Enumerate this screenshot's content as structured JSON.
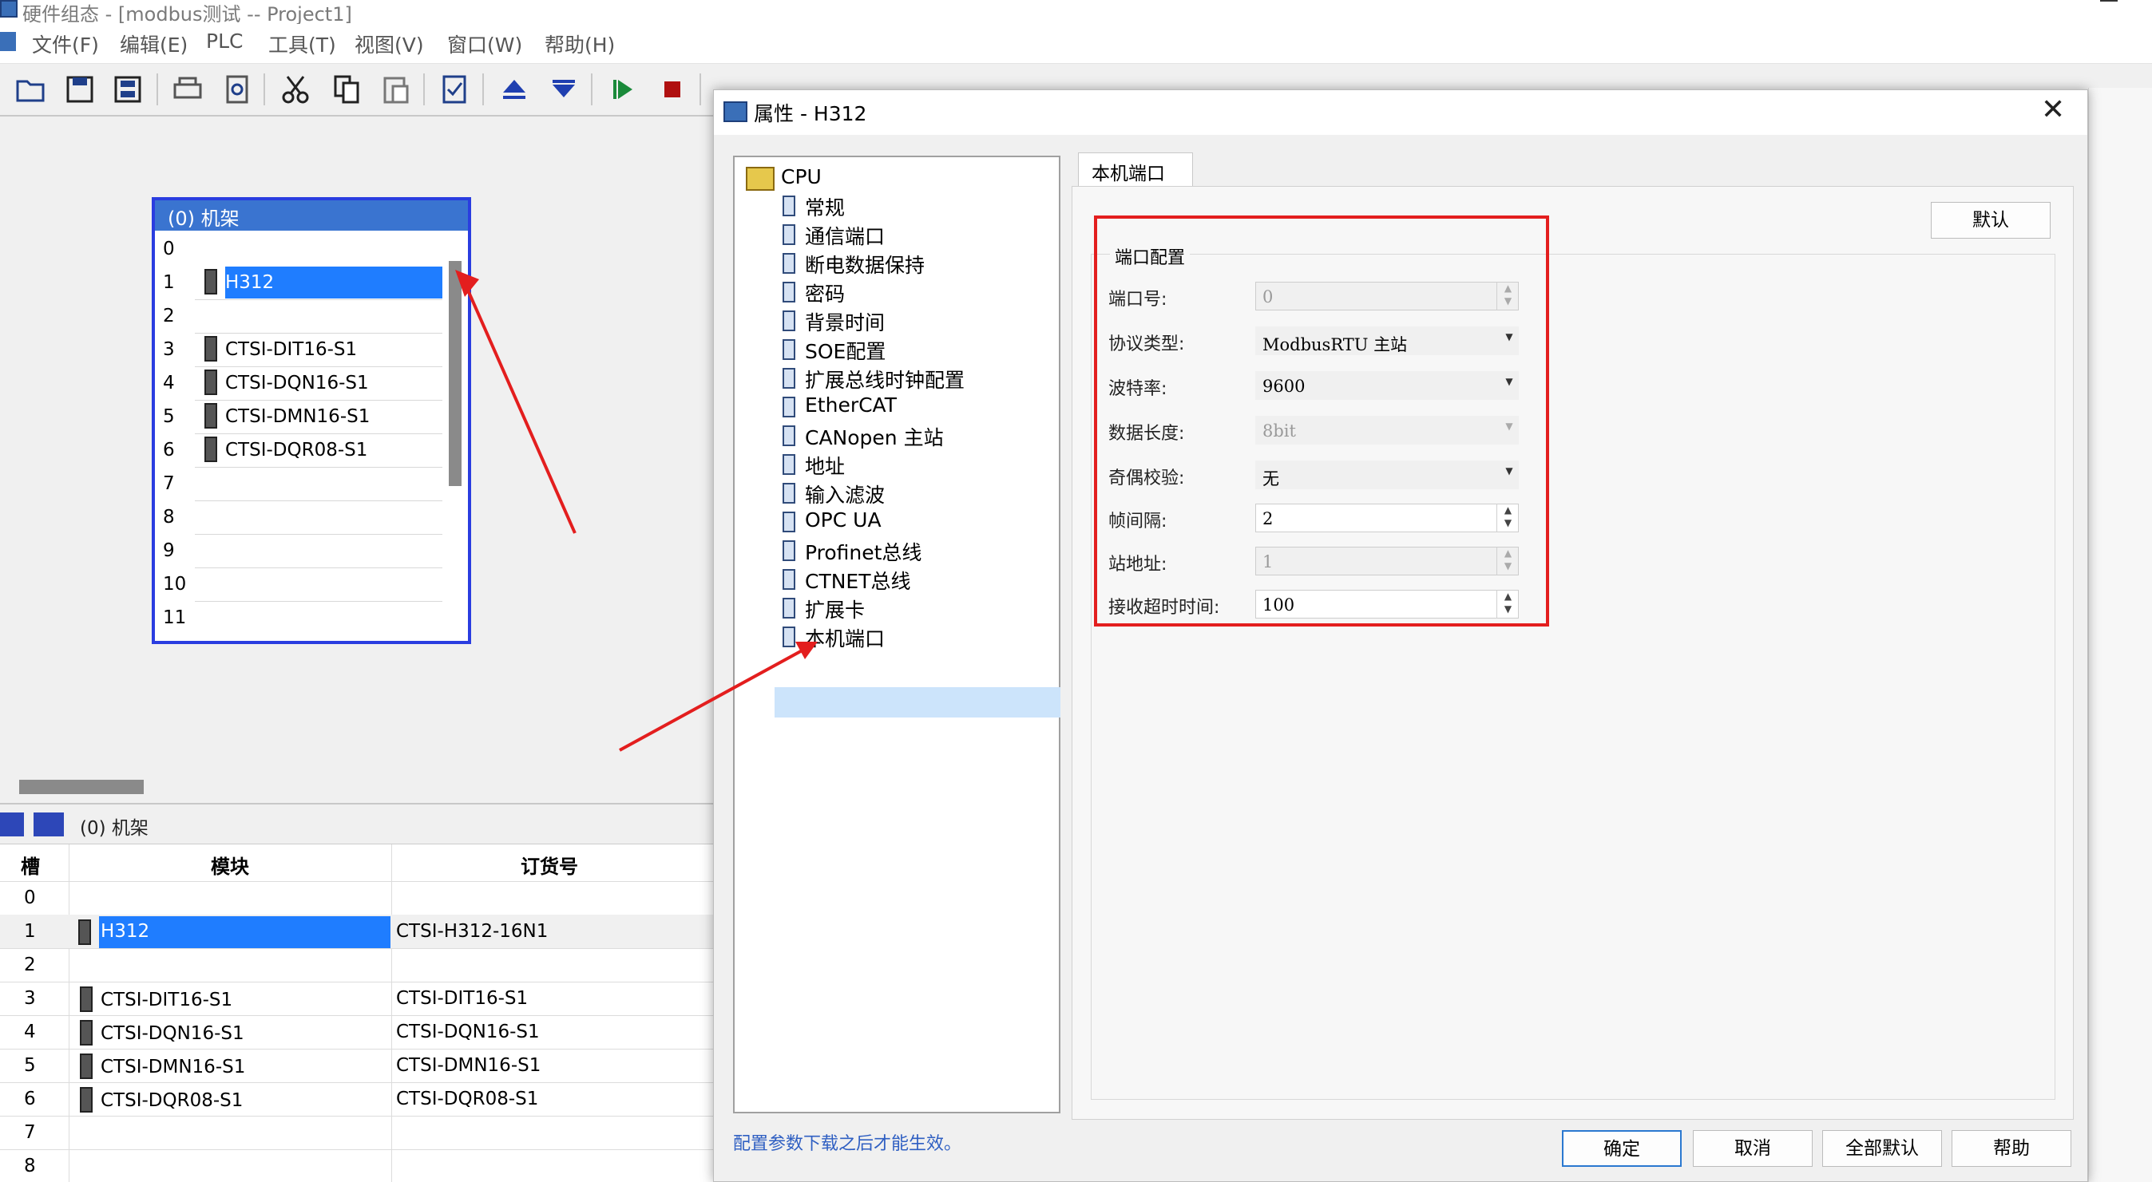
{
  "window": {
    "title": "硬件组态 - [modbus测试 -- Project1]"
  },
  "menu": [
    "文件(F)",
    "编辑(E)",
    "PLC",
    "工具(T)",
    "视图(V)",
    "窗口(W)",
    "帮助(H)"
  ],
  "toolbar_icons": [
    "open-icon",
    "save-icon",
    "save-all-icon",
    "print-icon",
    "print-preview-icon",
    "cut-icon",
    "copy-icon",
    "paste-icon",
    "check-icon",
    "upload-icon",
    "download-icon",
    "run-icon",
    "stop-icon"
  ],
  "rack": {
    "title": "(0)  机架",
    "rows": [
      "0",
      "1",
      "2",
      "3",
      "4",
      "5",
      "6",
      "7",
      "8",
      "9",
      "10",
      "11"
    ],
    "modules": [
      {
        "slot": "1",
        "name": "H312"
      },
      {
        "slot": "3",
        "name": "CTSI-DIT16-S1"
      },
      {
        "slot": "4",
        "name": "CTSI-DQN16-S1"
      },
      {
        "slot": "5",
        "name": "CTSI-DMN16-S1"
      },
      {
        "slot": "6",
        "name": "CTSI-DQR08-S1"
      }
    ]
  },
  "bottom": {
    "nav_label": "(0)  机架",
    "headers": {
      "slot": "槽",
      "module": "模块",
      "order": "订货号"
    },
    "rows": [
      {
        "slot": "0",
        "module": "",
        "order": ""
      },
      {
        "slot": "1",
        "module": "H312",
        "order": "CTSI-H312-16N1"
      },
      {
        "slot": "2",
        "module": "",
        "order": ""
      },
      {
        "slot": "3",
        "module": "CTSI-DIT16-S1",
        "order": "CTSI-DIT16-S1"
      },
      {
        "slot": "4",
        "module": "CTSI-DQN16-S1",
        "order": "CTSI-DQN16-S1"
      },
      {
        "slot": "5",
        "module": "CTSI-DMN16-S1",
        "order": "CTSI-DMN16-S1"
      },
      {
        "slot": "6",
        "module": "CTSI-DQR08-S1",
        "order": "CTSI-DQR08-S1"
      },
      {
        "slot": "7",
        "module": "",
        "order": ""
      },
      {
        "slot": "8",
        "module": "",
        "order": ""
      }
    ]
  },
  "dialog": {
    "title": "属性 - H312",
    "tree": {
      "root": "CPU",
      "items": [
        "常规",
        "通信端口",
        "断电数据保持",
        "密码",
        "背景时间",
        "SOE配置",
        "扩展总线时钟配置",
        "EtherCAT",
        "CANopen 主站",
        "地址",
        "输入滤波",
        "OPC UA",
        "Profinet总线",
        "CTNET总线",
        "扩展卡",
        "本机端口"
      ],
      "selected": "本机端口"
    },
    "tab": "本机端口",
    "default_button": "默认",
    "group_title": "端口配置",
    "fields": {
      "port_no": {
        "label": "端口号:",
        "value": "0"
      },
      "protocol": {
        "label": "协议类型:",
        "value": "ModbusRTU 主站"
      },
      "baud": {
        "label": "波特率:",
        "value": "9600"
      },
      "data_len": {
        "label": "数据长度:",
        "value": "8bit"
      },
      "parity": {
        "label": "奇偶校验:",
        "value": "无"
      },
      "frame_gap": {
        "label": "帧间隔:",
        "value": "2"
      },
      "station": {
        "label": "站地址:",
        "value": "1"
      },
      "timeout": {
        "label": "接收超时时间:",
        "value": "100"
      }
    },
    "footer_note": "配置参数下载之后才能生效。",
    "buttons": {
      "ok": "确定",
      "cancel": "取消",
      "all_default": "全部默认",
      "help": "帮助"
    }
  },
  "colors": {
    "selection": "#1f7dff",
    "rack_border": "#2a3de0",
    "annotation": "#e31e1e",
    "tree_selection": "#cce4fb"
  }
}
